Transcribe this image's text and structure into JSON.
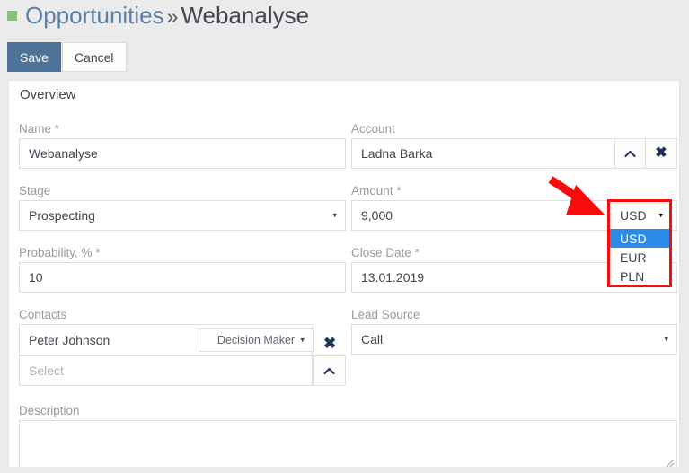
{
  "header": {
    "breadcrumb_root": "Opportunities",
    "breadcrumb_separator": "»",
    "breadcrumb_current": "Webanalyse",
    "bullet_color": "#8cc07a",
    "title_color": "#5b7fa6"
  },
  "toolbar": {
    "save_label": "Save",
    "cancel_label": "Cancel",
    "save_bg": "#4e7398"
  },
  "panel": {
    "title": "Overview"
  },
  "fields": {
    "name": {
      "label": "Name *",
      "value": "Webanalyse"
    },
    "account": {
      "label": "Account",
      "value": "Ladna Barka",
      "up_icon": "caret-up-icon",
      "clear_icon": "close-x-icon"
    },
    "stage": {
      "label": "Stage",
      "value": "Prospecting",
      "caret": "▾"
    },
    "amount": {
      "label": "Amount *",
      "value": "9,000"
    },
    "probability": {
      "label": "Probability, % *",
      "value": "10"
    },
    "close_date": {
      "label": "Close Date *",
      "value": "13.01.2019"
    },
    "contacts": {
      "label": "Contacts",
      "rows": [
        {
          "name": "Peter Johnson",
          "role": "Decision Maker",
          "role_caret": "▾",
          "remove_icon": "close-x-icon"
        }
      ],
      "select_placeholder": "Select",
      "collapse_icon": "caret-up-icon"
    },
    "lead_source": {
      "label": "Lead Source",
      "value": "Call",
      "caret": "▾"
    },
    "description": {
      "label": "Description",
      "value": ""
    }
  },
  "currency_dropdown": {
    "selected": "USD",
    "caret": "▾",
    "options": [
      {
        "label": "USD",
        "selected": true
      },
      {
        "label": "EUR",
        "selected": false
      },
      {
        "label": "PLN",
        "selected": false
      }
    ],
    "highlight_color": "#2a8ce8",
    "annotation_color": "#f80c0c"
  },
  "annotation": {
    "arrow_color": "#f80c0c",
    "arrow_target": "currency-dropdown"
  }
}
